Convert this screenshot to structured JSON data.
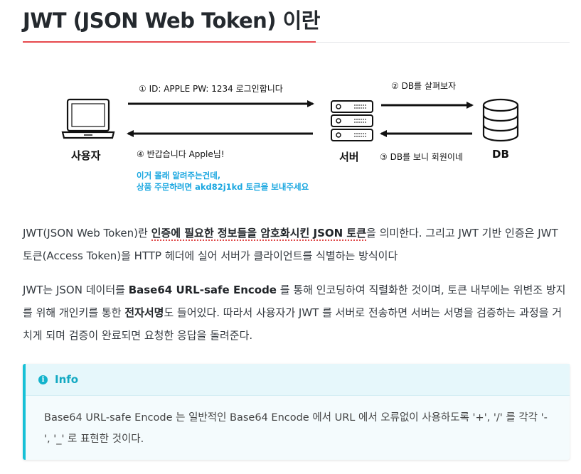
{
  "article": {
    "title": "JWT (JSON Web Token) 이란"
  },
  "diagram": {
    "client_label": "사용자",
    "server_label": "서버",
    "db_label": "DB",
    "msg_login": "① ID: APPLE PW: 1234 로그인합니다",
    "msg_greet": "④ 반갑습니다 Apple님!",
    "msg_db_look": "② DB를 살펴보자",
    "msg_db_member": "③ DB를 보니 회원이네",
    "note_line1": "이거 몰래 알려주는건데,",
    "note_line2": "상품 주문하려면 akd82j1kd 토큰을 보내주세요"
  },
  "paragraph1": {
    "part1": "JWT(JSON Web Token)란 ",
    "bold": "인증에 필요한 정보들을 암호화시킨 JSON 토큰",
    "part2": "을 의미한다. 그리고 JWT 기반 인증은 JWT 토큰(Access Token)을 HTTP 헤더에 실어 서버가 클라이언트를 식별하는 방식이다"
  },
  "paragraph2": {
    "part1": "JWT는 JSON 데이터를 ",
    "bold1": "Base64 URL-safe Encode",
    "part2": " 를 통해 인코딩하여 직렬화한 것이며, 토큰 내부에는 위변조 방지를 위해 개인키를 통한 ",
    "bold2": "전자서명",
    "part3": "도 들어있다. 따라서 사용자가 JWT 를 서버로 전송하면 서버는 서명을 검증하는 과정을 거치게 되며 검증이 완료되면 요청한 응답을 돌려준다."
  },
  "info_box": {
    "title": "Info",
    "icon": "info-circle-icon",
    "body": "Base64 URL-safe Encode 는 일반적인 Base64 Encode 에서 URL 에서 오류없이 사용하도록 '+', '/' 를 각각 '-', '_' 로 표현한 것이다."
  },
  "colors": {
    "accent_red": "#e6484d",
    "info_cyan": "#17c0d6",
    "note_blue": "#1aa7e0"
  }
}
